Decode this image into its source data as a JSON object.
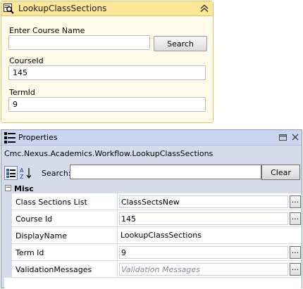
{
  "activity": {
    "title": "LookupClassSections",
    "enter_course_label": "Enter Course Name",
    "course_name_value": "",
    "search_button": "Search",
    "course_id_label": "CourseId",
    "course_id_value": "145",
    "term_id_label": "TermId",
    "term_id_value": "9"
  },
  "properties": {
    "title": "Properties",
    "object_name": "Cmc.Nexus.Academics.Workflow.LookupClassSections",
    "toolbar": {
      "search_label": "Search:",
      "search_value": "",
      "clear_button": "Clear"
    },
    "category": {
      "toggle": "−",
      "label": "Misc"
    },
    "rows": [
      {
        "name": "Class Sections List",
        "value": "ClassSectsNew"
      },
      {
        "name": "Course Id",
        "value": "145"
      },
      {
        "name": "DisplayName",
        "value": "LookupClassSections"
      },
      {
        "name": "Term Id",
        "value": "9"
      },
      {
        "name": "ValidationMessages",
        "value": "Validation Messages"
      }
    ],
    "ellipsis": "..."
  },
  "icons": {
    "activity": "search-activity-icon",
    "collapse": "chevron-up-double-icon",
    "properties": "properties-list-icon",
    "pin": "window-position-icon",
    "close": "close-icon",
    "categorized": "categorized-icon",
    "alphabetical": "sort-alphabetical-icon"
  },
  "colors": {
    "activity_header": "#fde698",
    "activity_border": "#e5c365",
    "panel_background": "#d6dbe9",
    "watermark": "#8a8a8a"
  }
}
